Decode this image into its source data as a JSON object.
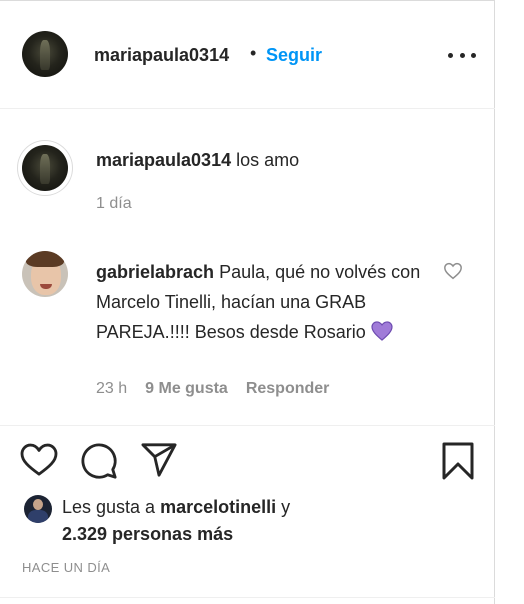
{
  "header": {
    "username": "mariapaula0314",
    "dot": "•",
    "follow_label": "Seguir",
    "more_icon": "more-horizontal-icon"
  },
  "caption": {
    "username": "mariapaula0314",
    "text": "los amo",
    "time": "1 día"
  },
  "comment": {
    "username": "gabrielabrach",
    "text": "Paula, qué no volvés con Marcelo Tinelli, hacían una GRAB PAREJA.!!!! Besos desde Rosario",
    "emoji_icon": "purple-heart-icon",
    "time": "23 h",
    "likes": "9 Me gusta",
    "reply_label": "Responder"
  },
  "actions": {
    "like_icon": "heart-icon",
    "comment_icon": "comment-icon",
    "share_icon": "paper-plane-icon",
    "save_icon": "bookmark-icon"
  },
  "likes": {
    "prefix": "Les gusta a",
    "user": "marcelotinelli",
    "suffix": "y",
    "others": "2.329 personas más"
  },
  "posted": "HACE UN DÍA",
  "colors": {
    "link": "#0095f6",
    "text": "#262626",
    "muted": "#8e8e8e",
    "purple_heart": "#a07bd8"
  }
}
